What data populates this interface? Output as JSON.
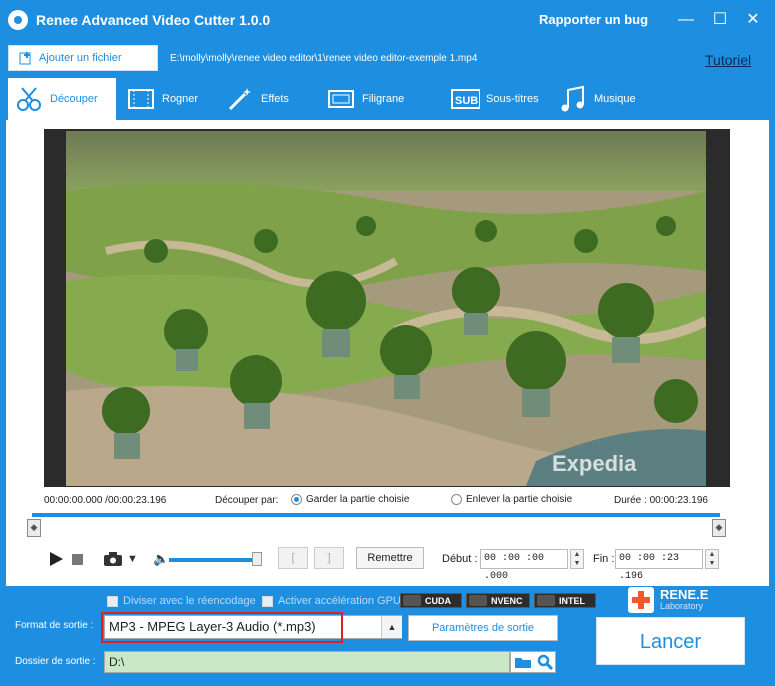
{
  "app": {
    "title": "Renee Advanced Video Cutter 1.0.0",
    "bug_link": "Rapporter un bug"
  },
  "window_controls": {
    "minimize": "—",
    "maximize": "☐",
    "close": "✕"
  },
  "file": {
    "add_label": "Ajouter un fichier",
    "path": "E:\\molly\\molly\\renee video editor\\1\\renee video editor-exemple 1.mp4",
    "tutorial": "Tutoriel"
  },
  "tabs": [
    {
      "label": "Découper",
      "icon": "scissors-icon",
      "active": true
    },
    {
      "label": "Rogner",
      "icon": "crop-icon",
      "active": false
    },
    {
      "label": "Effets",
      "icon": "magic-wand-icon",
      "active": false
    },
    {
      "label": "Filigrane",
      "icon": "watermark-icon",
      "active": false
    },
    {
      "label": "Sous-titres",
      "icon": "subtitle-icon",
      "active": false
    },
    {
      "label": "Musique",
      "icon": "music-note-icon",
      "active": false
    }
  ],
  "video": {
    "watermark": "Expedia"
  },
  "cut": {
    "time_range": "00:00:00.000 /00:00:23.196",
    "label": "Découper par:",
    "options": [
      {
        "label": "Garder la partie choisie",
        "selected": true
      },
      {
        "label": "Enlever la partie choisie",
        "selected": false
      }
    ],
    "duration": "Durée : 00:00:23.196"
  },
  "controls": {
    "reset": "Remettre",
    "start_label": "Début :",
    "start_value": "00 :00 :00 .000",
    "end_label": "Fin :",
    "end_value": "00 :00 :23 .196",
    "bracket_open": "[",
    "bracket_close": "]",
    "volume_level": 0.85
  },
  "options": {
    "split_reencode": "Diviser avec le réencodage",
    "gpu_accel": "Activer accélération GPU",
    "gpu_badges": [
      "CUDA",
      "NVENC",
      "INTEL"
    ]
  },
  "brand": {
    "name": "RENE.E",
    "sub": "Laboratory"
  },
  "output": {
    "format_label": "Format de sortie :",
    "format_value": "MP3 - MPEG Layer-3 Audio (*.mp3)",
    "params_button": "Paramètres de sortie",
    "folder_label": "Dossier de sortie :",
    "folder_value": "D:\\",
    "launch": "Lancer"
  },
  "colors": {
    "accent": "#1e8fe0",
    "highlight": "#e02020",
    "folder_bg": "#c9e9c6"
  }
}
